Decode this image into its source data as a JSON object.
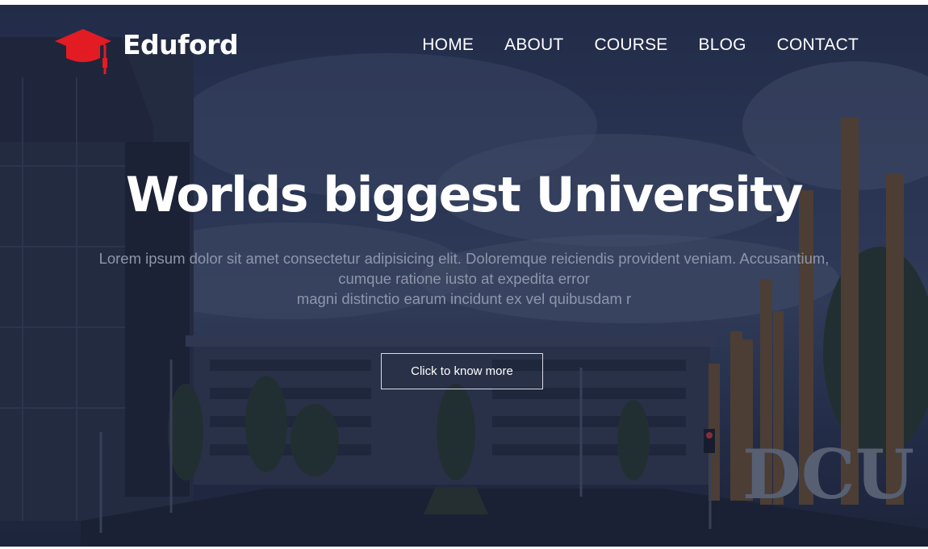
{
  "brand": {
    "name": "Eduford",
    "logo_icon": "graduation-cap-icon",
    "accent_color": "#e31b23"
  },
  "nav": {
    "items": [
      {
        "label": "HOME"
      },
      {
        "label": "ABOUT"
      },
      {
        "label": "COURSE"
      },
      {
        "label": "BLOG"
      },
      {
        "label": "CONTACT"
      }
    ]
  },
  "hero": {
    "title": "Worlds biggest University",
    "description_lines": [
      "Lorem ipsum dolor sit amet consectetur adipisicing elit. Doloremque reiciendis provident veniam. Accusantium,",
      "cumque ratione iusto at expedita error",
      "magni distinctio earum incidunt ex vel quibusdam r"
    ],
    "button_label": "Click to know more",
    "sign_text": "DCU"
  }
}
